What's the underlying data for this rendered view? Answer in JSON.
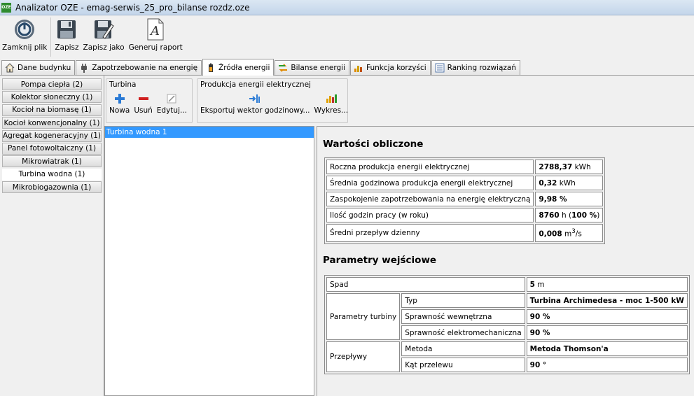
{
  "window": {
    "app_badge": "OZE",
    "title": "Analizator OZE - emag-serwis_25_pro_bilanse rozdz.oze"
  },
  "toolbar": {
    "close_label": "Zamknij plik",
    "save_label": "Zapisz",
    "save_as_label": "Zapisz jako",
    "report_label": "Generuj raport"
  },
  "tabs": [
    {
      "label": "Dane budynku",
      "icon": "house-icon"
    },
    {
      "label": "Zapotrzebowanie na energię",
      "icon": "plug-icon"
    },
    {
      "label": "Źródła energii",
      "icon": "battery-icon"
    },
    {
      "label": "Bilanse energii",
      "icon": "exchange-icon"
    },
    {
      "label": "Funkcja korzyści",
      "icon": "chart-icon"
    },
    {
      "label": "Ranking rozwiązań",
      "icon": "list-icon"
    }
  ],
  "sources": [
    {
      "label": "Pompa ciepła (2)"
    },
    {
      "label": "Kolektor słoneczny (1)"
    },
    {
      "label": "Kocioł na biomasę (1)"
    },
    {
      "label": "Kocioł konwencjonalny (1)"
    },
    {
      "label": "Agregat kogeneracyjny (1)"
    },
    {
      "label": "Panel fotowoltaiczny (1)"
    },
    {
      "label": "Mikrowiatrak (1)"
    },
    {
      "label": "Turbina wodna (1)"
    },
    {
      "label": "Mikrobiogazownia (1)"
    }
  ],
  "turbine_group": {
    "title": "Turbina",
    "new_label": "Nowa",
    "delete_label": "Usuń",
    "edit_label": "Edytuj..."
  },
  "production_group": {
    "title": "Produkcja energii elektrycznej",
    "export_label": "Eksportuj wektor godzinowy...",
    "chart_label": "Wykres..."
  },
  "list": {
    "items": [
      "Turbina wodna 1"
    ]
  },
  "computed": {
    "title": "Wartości obliczone",
    "rows": [
      {
        "label": "Roczna produkcja energii elektrycznej",
        "value": "2788,37",
        "unit": "kWh"
      },
      {
        "label": "Średnia godzinowa produkcja energii elektrycznej",
        "value": "0,32",
        "unit": "kWh"
      },
      {
        "label": "Zaspokojenie zapotrzebowania na energię elektryczną",
        "value": "9,98 %",
        "unit": ""
      },
      {
        "label": "Ilość godzin pracy (w roku)",
        "value": "8760",
        "unit": "h",
        "extra_open": "(",
        "extra": "100 %",
        "extra_close": ")"
      },
      {
        "label": "Średni przepływ dzienny",
        "value": "0,008",
        "unit": "m",
        "unit_sup": "3",
        "unit_suffix": "/s"
      }
    ]
  },
  "inputs": {
    "title": "Parametry wejściowe",
    "spad": {
      "label": "Spad",
      "value": "5",
      "unit": "m"
    },
    "turbine_params": {
      "label": "Parametry turbiny",
      "rows": [
        {
          "label": "Typ",
          "value": "Turbina Archimedesa - moc 1-500 kW"
        },
        {
          "label": "Sprawność wewnętrzna",
          "value": "90 %"
        },
        {
          "label": "Sprawność elektromechaniczna",
          "value": "90 %"
        }
      ]
    },
    "flows": {
      "label": "Przepływy",
      "rows": [
        {
          "label": "Metoda",
          "value": "Metoda Thomson'a"
        },
        {
          "label": "Kąt przelewu",
          "value": "90 °"
        }
      ]
    }
  }
}
